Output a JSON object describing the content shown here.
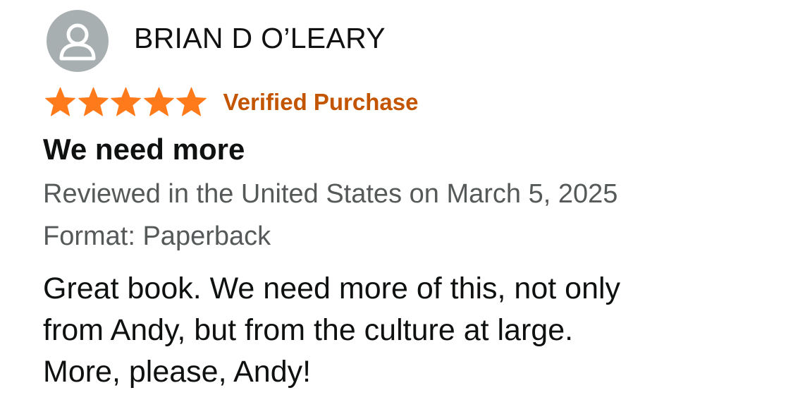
{
  "review": {
    "reviewer_name": "BRIAN D O’LEARY",
    "rating": 5,
    "rating_max": 5,
    "verified_label": "Verified Purchase",
    "title": "We need more",
    "date_line": "Reviewed in the United States on March 5, 2025",
    "format_line": "Format: Paperback",
    "body_lines": [
      "Great book. We need more of this, not only",
      "from Andy, but from the culture at large.",
      "More, please, Andy!"
    ]
  },
  "icons": {
    "avatar": "user-silhouette-icon",
    "star": "star-icon"
  },
  "colors": {
    "star": "#ff7a1a",
    "verified": "#c45500",
    "meta_text": "#565959",
    "avatar_bg": "#a8afb1"
  }
}
